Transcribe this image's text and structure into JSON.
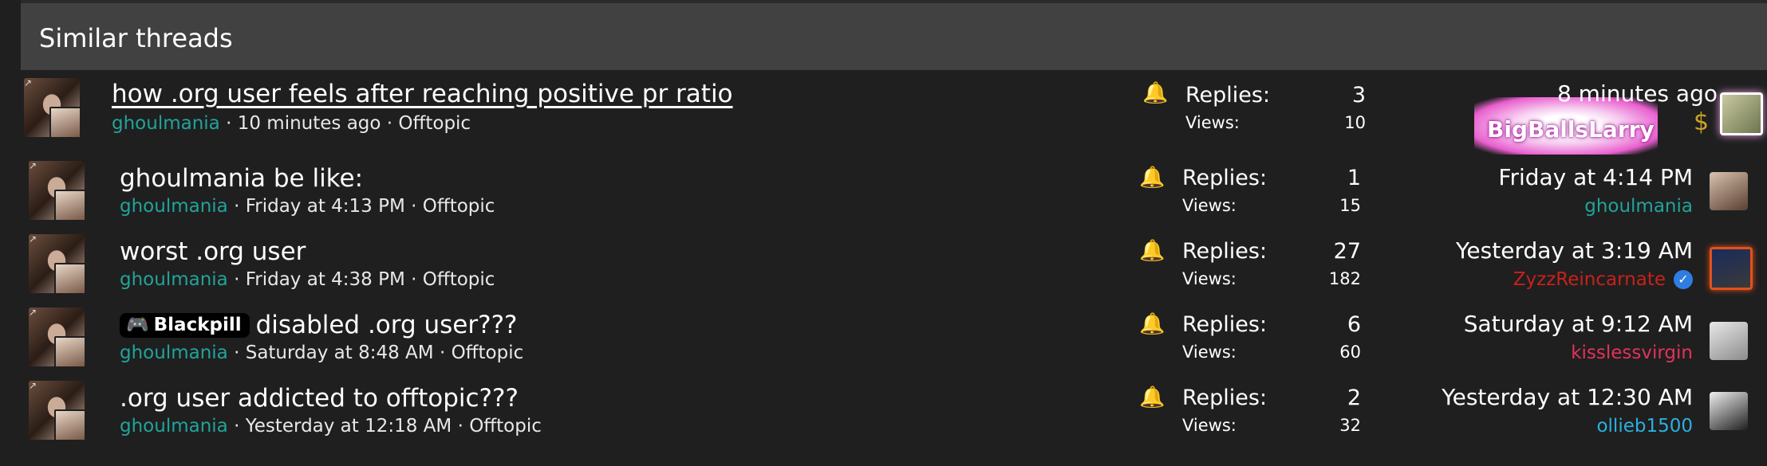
{
  "section": {
    "title": "Similar threads"
  },
  "stat_labels": {
    "replies": "Replies:",
    "views": "Views:"
  },
  "threads": [
    {
      "title": "how .org user feels after reaching positive pr ratio",
      "author": "ghoulmania",
      "meta_rest": " · 10 minutes ago · Offtopic",
      "replies": "3",
      "views": "10",
      "last_date": "8 minutes ago",
      "last_user": "BigBallsLarry",
      "last_user_color": "#ffffff"
    },
    {
      "title": "ghoulmania be like:",
      "author": "ghoulmania",
      "meta_rest": " · Friday at 4:13 PM · Offtopic",
      "replies": "1",
      "views": "15",
      "last_date": "Friday at 4:14 PM",
      "last_user": "ghoulmania",
      "last_user_color": "#22a39a"
    },
    {
      "title": "worst .org user",
      "author": "ghoulmania",
      "meta_rest": " · Friday at 4:38 PM · Offtopic",
      "replies": "27",
      "views": "182",
      "last_date": "Yesterday at 3:19 AM",
      "last_user": "ZyzzReincarnate",
      "last_user_color": "#c8211c"
    },
    {
      "prefix": "Blackpill",
      "title": "disabled .org user???",
      "author": "ghoulmania",
      "meta_rest": " · Saturday at 8:48 AM · Offtopic",
      "replies": "6",
      "views": "60",
      "last_date": "Saturday at 9:12 AM",
      "last_user": "kisslessvirgin",
      "last_user_color": "#e0335a"
    },
    {
      "title": ".org user addicted to offtopic???",
      "author": "ghoulmania",
      "meta_rest": " · Yesterday at 12:18 AM · Offtopic",
      "replies": "2",
      "views": "32",
      "last_date": "Yesterday at 12:30 AM",
      "last_user": "ollieb1500",
      "last_user_color": "#2bb0e0"
    }
  ],
  "icons": {
    "watch": "bell-icon",
    "verified": "check-badge-icon",
    "prefix": "gamepad-icon"
  }
}
